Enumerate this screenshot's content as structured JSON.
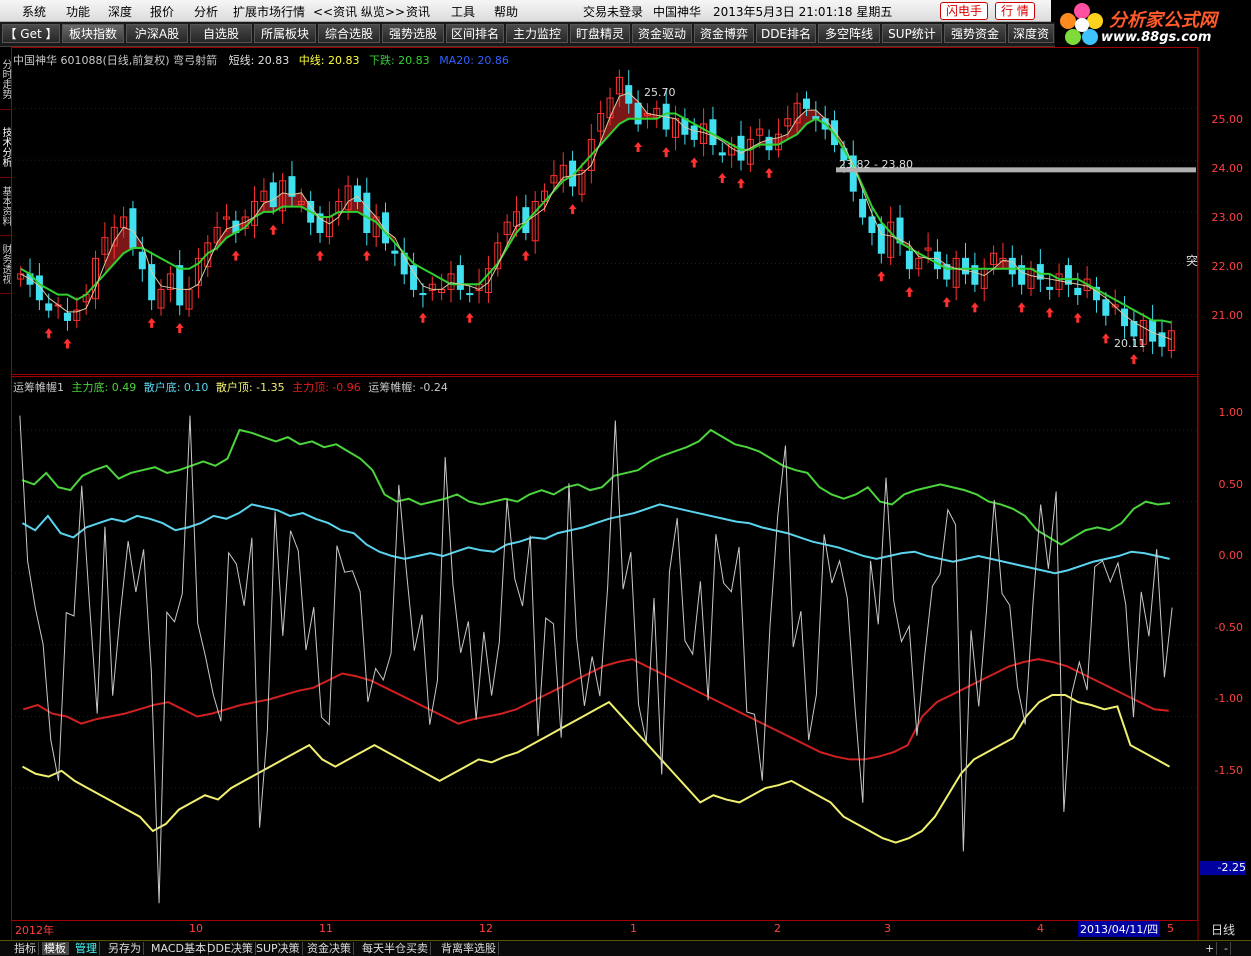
{
  "menu": {
    "items": [
      "系统",
      "功能",
      "深度",
      "报价",
      "分析",
      "扩展市场行情",
      "<<资讯 纵览>>",
      "资讯",
      "工具",
      "帮助"
    ],
    "login_status": "交易未登录",
    "stock_name": "中国神华",
    "datetime": "2013年5月3日 21:01:18 星期五",
    "flash_label": "闪电手",
    "quote_label": "行 情"
  },
  "logo": {
    "title": "分析家公式网",
    "url": "www.88gs.com"
  },
  "toolbar": {
    "get_label": "【 Get 】",
    "tabs": [
      "板块指数",
      "沪深A股",
      "自选股",
      "所属板块",
      "综合选股",
      "强势选股",
      "区间排名",
      "主力监控",
      "盯盘精灵",
      "资金驱动",
      "资金博弈",
      "DDE排名",
      "多空阵线",
      "SUP统计",
      "强势资金",
      "深度资"
    ]
  },
  "side_tabs": [
    "分时走势",
    "技术分析",
    "基本资料",
    "财务透视"
  ],
  "price_panel": {
    "title": "中国神华 601088(日线,前复权) 弯弓射箭",
    "short_label": "短线: 20.83",
    "mid_label": "中线: 20.83",
    "fall_label": "下跌: 20.83",
    "ma_label": "MA20: 20.86",
    "high_marker": "25.70",
    "range_marker": "23.82 - 23.80",
    "low_marker": "20.11",
    "break_label": "突",
    "y_ticks": [
      "25.00",
      "24.00",
      "23.00",
      "22.00",
      "21.00"
    ]
  },
  "indicator_panel": {
    "name": "运筹帷幄1",
    "main_bottom_label": "主力底: 0.49",
    "retail_bottom_label": "散户底: 0.10",
    "retail_top_label": "散户顶: -1.35",
    "main_top_label": "主力顶: -0.96",
    "yc_label": "运筹帷幄: -0.24",
    "y_ticks": [
      "1.00",
      "0.50",
      "0.00",
      "-0.50",
      "-1.00",
      "-1.50"
    ],
    "cursor_value": "-2.25"
  },
  "x_axis": {
    "labels": [
      "2012年",
      "10",
      "11",
      "12",
      "1",
      "2",
      "3",
      "4",
      "2013/04/11/四",
      "5"
    ],
    "period": "日线"
  },
  "status_bar": {
    "items": [
      "指标",
      "模板",
      "管理",
      "另存为",
      "MACD基本",
      "DDE决策",
      "SUP决策",
      "资金决策",
      "每天半仓买卖",
      "背离率选股"
    ],
    "plus": "+",
    "minus": "-"
  },
  "colors": {
    "up_candle": "#ff3030",
    "down_candle": "#40e0f0",
    "ma_green": "#30d030",
    "fill_red": "#8b1a1a",
    "main_bottom": "#4cd43c",
    "retail_bottom": "#5ad4ee",
    "retail_top": "#f0f070",
    "main_top": "#d02020",
    "yc_line": "#c8c8c8"
  },
  "chart_data": [
    {
      "type": "candlestick",
      "title": "中国神华 601088(日线,前复权) 弯弓射箭",
      "ylim": [
        20.0,
        25.8
      ],
      "y_ticks": [
        21.0,
        22.0,
        23.0,
        24.0,
        25.0
      ],
      "x_labels": [
        "2012年",
        "10",
        "11",
        "12",
        "1",
        "2",
        "3",
        "4",
        "5"
      ],
      "close": [
        21.8,
        21.6,
        21.3,
        21.1,
        21.2,
        20.9,
        21.1,
        21.4,
        22.1,
        22.5,
        22.7,
        22.9,
        22.3,
        21.9,
        21.3,
        21.5,
        21.8,
        21.2,
        21.5,
        22.1,
        22.4,
        22.7,
        22.9,
        22.6,
        22.9,
        23.2,
        23.4,
        23.1,
        23.6,
        23.3,
        23.2,
        22.8,
        22.6,
        22.9,
        23.2,
        23.5,
        23.2,
        22.6,
        22.9,
        22.4,
        22.2,
        21.8,
        21.5,
        21.4,
        21.6,
        21.5,
        21.8,
        21.5,
        21.4,
        21.6,
        21.9,
        22.4,
        22.8,
        23.0,
        22.6,
        23.2,
        23.4,
        23.7,
        23.9,
        23.5,
        23.8,
        24.4,
        24.9,
        25.2,
        25.6,
        25.1,
        24.7,
        24.9,
        25.0,
        24.6,
        24.8,
        24.5,
        24.4,
        24.7,
        24.3,
        24.1,
        24.3,
        24.0,
        24.4,
        24.6,
        24.2,
        24.5,
        24.8,
        25.1,
        25.0,
        24.8,
        24.6,
        24.3,
        24.0,
        23.4,
        22.9,
        22.6,
        22.2,
        22.8,
        22.4,
        21.9,
        22.1,
        22.3,
        21.9,
        21.7,
        22.1,
        21.8,
        21.6,
        21.9,
        22.2,
        22.1,
        21.8,
        21.6,
        21.9,
        21.7,
        21.5,
        21.8,
        21.6,
        21.4,
        21.7,
        21.3,
        21.0,
        21.2,
        20.8,
        20.6,
        20.9,
        20.5,
        20.4,
        20.7
      ],
      "series": [
        {
          "name": "短线",
          "last": 20.83
        },
        {
          "name": "中线",
          "last": 20.83
        },
        {
          "name": "下跌",
          "last": 20.83
        },
        {
          "name": "MA20",
          "last": 20.86,
          "values": [
            21.9,
            21.8,
            21.6,
            21.5,
            21.4,
            21.4,
            21.3,
            21.4,
            21.6,
            21.8,
            22.0,
            22.2,
            22.3,
            22.3,
            22.2,
            22.1,
            22.0,
            21.9,
            21.9,
            22.0,
            22.2,
            22.3,
            22.5,
            22.6,
            22.7,
            22.9,
            23.0,
            23.0,
            23.1,
            23.1,
            23.1,
            23.0,
            22.9,
            22.9,
            23.0,
            23.0,
            23.0,
            22.9,
            22.8,
            22.6,
            22.4,
            22.2,
            22.0,
            21.9,
            21.8,
            21.7,
            21.6,
            21.6,
            21.6,
            21.6,
            21.8,
            22.0,
            22.3,
            22.6,
            22.8,
            23.0,
            23.2,
            23.4,
            23.6,
            23.7,
            23.9,
            24.1,
            24.3,
            24.5,
            24.7,
            24.8,
            24.8,
            24.8,
            24.8,
            24.9,
            24.9,
            24.8,
            24.7,
            24.6,
            24.5,
            24.4,
            24.3,
            24.2,
            24.2,
            24.3,
            24.3,
            24.3,
            24.4,
            24.5,
            24.7,
            24.8,
            24.7,
            24.5,
            24.2,
            23.9,
            23.5,
            23.1,
            22.8,
            22.6,
            22.4,
            22.3,
            22.2,
            22.1,
            22.0,
            21.9,
            21.9,
            21.9,
            21.9,
            21.9,
            21.9,
            21.9,
            21.9,
            21.9,
            21.9,
            21.8,
            21.8,
            21.7,
            21.7,
            21.7,
            21.6,
            21.5,
            21.4,
            21.3,
            21.2,
            21.1,
            21.0,
            20.9,
            20.9,
            20.86
          ]
        }
      ],
      "annotations": [
        "25.70",
        "23.82 - 23.80",
        "20.11"
      ]
    },
    {
      "type": "line",
      "title": "运筹帷幄1",
      "ylim": [
        -2.4,
        1.3
      ],
      "y_ticks": [
        1.0,
        0.5,
        0.0,
        -0.5,
        -1.0,
        -1.5
      ],
      "series": [
        {
          "name": "主力底",
          "last": 0.49,
          "values": [
            0.65,
            0.62,
            0.7,
            0.6,
            0.58,
            0.68,
            0.72,
            0.75,
            0.66,
            0.7,
            0.72,
            0.74,
            0.7,
            0.72,
            0.75,
            0.78,
            0.75,
            0.8,
            1.0,
            0.98,
            0.95,
            0.92,
            0.95,
            0.9,
            0.92,
            0.88,
            0.9,
            0.85,
            0.8,
            0.72,
            0.55,
            0.5,
            0.52,
            0.48,
            0.5,
            0.52,
            0.55,
            0.5,
            0.48,
            0.5,
            0.52,
            0.5,
            0.55,
            0.58,
            0.55,
            0.6,
            0.62,
            0.58,
            0.6,
            0.68,
            0.7,
            0.72,
            0.78,
            0.82,
            0.85,
            0.88,
            0.92,
            1.0,
            0.95,
            0.9,
            0.88,
            0.85,
            0.8,
            0.75,
            0.72,
            0.7,
            0.6,
            0.55,
            0.52,
            0.55,
            0.6,
            0.5,
            0.48,
            0.55,
            0.58,
            0.6,
            0.62,
            0.6,
            0.58,
            0.55,
            0.5,
            0.48,
            0.45,
            0.4,
            0.3,
            0.25,
            0.2,
            0.25,
            0.3,
            0.32,
            0.3,
            0.35,
            0.45,
            0.5,
            0.48,
            0.49
          ]
        },
        {
          "name": "散户底",
          "last": 0.1,
          "values": [
            0.35,
            0.3,
            0.4,
            0.28,
            0.25,
            0.32,
            0.35,
            0.38,
            0.36,
            0.4,
            0.38,
            0.35,
            0.3,
            0.32,
            0.35,
            0.4,
            0.38,
            0.42,
            0.48,
            0.46,
            0.44,
            0.4,
            0.42,
            0.38,
            0.35,
            0.3,
            0.28,
            0.2,
            0.15,
            0.12,
            0.1,
            0.12,
            0.14,
            0.12,
            0.15,
            0.18,
            0.16,
            0.15,
            0.2,
            0.22,
            0.25,
            0.24,
            0.28,
            0.3,
            0.32,
            0.35,
            0.38,
            0.4,
            0.42,
            0.45,
            0.48,
            0.46,
            0.44,
            0.42,
            0.4,
            0.38,
            0.36,
            0.35,
            0.32,
            0.3,
            0.28,
            0.25,
            0.22,
            0.2,
            0.18,
            0.15,
            0.12,
            0.1,
            0.12,
            0.14,
            0.15,
            0.12,
            0.1,
            0.08,
            0.1,
            0.12,
            0.1,
            0.08,
            0.06,
            0.04,
            0.02,
            0.0,
            0.02,
            0.05,
            0.08,
            0.1,
            0.12,
            0.15,
            0.14,
            0.12,
            0.1
          ]
        },
        {
          "name": "散户顶",
          "last": -1.35,
          "values": [
            -1.35,
            -1.4,
            -1.42,
            -1.38,
            -1.45,
            -1.5,
            -1.55,
            -1.6,
            -1.65,
            -1.7,
            -1.8,
            -1.75,
            -1.65,
            -1.6,
            -1.55,
            -1.58,
            -1.5,
            -1.45,
            -1.4,
            -1.35,
            -1.3,
            -1.25,
            -1.2,
            -1.3,
            -1.35,
            -1.3,
            -1.25,
            -1.2,
            -1.25,
            -1.3,
            -1.35,
            -1.4,
            -1.45,
            -1.4,
            -1.35,
            -1.3,
            -1.32,
            -1.28,
            -1.25,
            -1.2,
            -1.15,
            -1.1,
            -1.05,
            -1.0,
            -0.95,
            -0.9,
            -1.0,
            -1.1,
            -1.2,
            -1.3,
            -1.4,
            -1.5,
            -1.6,
            -1.55,
            -1.58,
            -1.6,
            -1.55,
            -1.5,
            -1.48,
            -1.45,
            -1.5,
            -1.55,
            -1.6,
            -1.7,
            -1.75,
            -1.8,
            -1.85,
            -1.88,
            -1.85,
            -1.8,
            -1.7,
            -1.55,
            -1.4,
            -1.3,
            -1.25,
            -1.2,
            -1.15,
            -1.0,
            -0.9,
            -0.85,
            -0.85,
            -0.9,
            -0.92,
            -0.95,
            -0.93,
            -1.2,
            -1.25,
            -1.3,
            -1.35
          ]
        },
        {
          "name": "主力顶",
          "last": -0.96,
          "values": [
            -0.95,
            -0.92,
            -0.98,
            -1.0,
            -1.05,
            -1.02,
            -1.0,
            -0.98,
            -0.95,
            -0.92,
            -0.9,
            -0.95,
            -1.0,
            -0.98,
            -0.95,
            -0.92,
            -0.9,
            -0.88,
            -0.85,
            -0.82,
            -0.8,
            -0.75,
            -0.7,
            -0.72,
            -0.75,
            -0.8,
            -0.85,
            -0.9,
            -0.95,
            -1.0,
            -1.05,
            -1.02,
            -1.0,
            -0.98,
            -0.95,
            -0.9,
            -0.85,
            -0.8,
            -0.75,
            -0.7,
            -0.65,
            -0.62,
            -0.6,
            -0.65,
            -0.7,
            -0.75,
            -0.8,
            -0.85,
            -0.9,
            -0.95,
            -1.0,
            -1.05,
            -1.1,
            -1.15,
            -1.2,
            -1.25,
            -1.28,
            -1.3,
            -1.3,
            -1.28,
            -1.25,
            -1.2,
            -1.0,
            -0.9,
            -0.85,
            -0.8,
            -0.75,
            -0.7,
            -0.65,
            -0.62,
            -0.6,
            -0.62,
            -0.65,
            -0.7,
            -0.75,
            -0.8,
            -0.85,
            -0.9,
            -0.95,
            -0.96
          ]
        },
        {
          "name": "运筹帷幄",
          "last": -0.24
        }
      ]
    }
  ]
}
